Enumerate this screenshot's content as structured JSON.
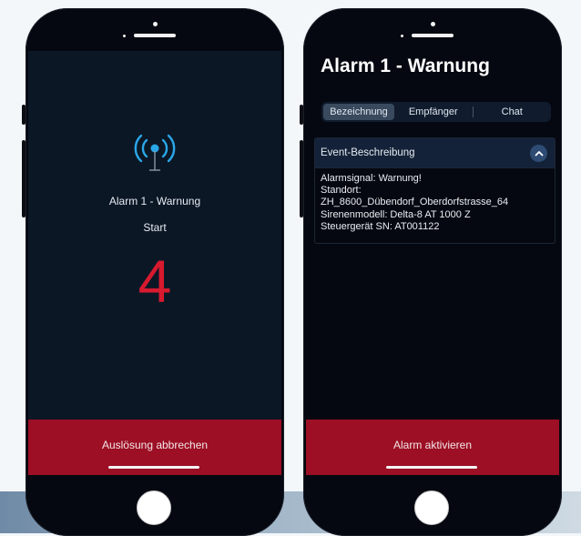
{
  "left_phone": {
    "alarm_title": "Alarm 1 - Warnung",
    "status": "Start",
    "countdown": "4",
    "cancel_button": "Auslösung abbrechen",
    "icon": "broadcast-antenna-icon"
  },
  "right_phone": {
    "title": "Alarm 1 - Warnung",
    "tabs": [
      {
        "label": "Bezeichnung",
        "active": true
      },
      {
        "label": "Empfänger",
        "active": false
      },
      {
        "label": "Chat",
        "active": false
      }
    ],
    "event_section": {
      "header": "Event-Beschreibung",
      "lines": [
        "Alarmsignal: Warnung!",
        "Standort:",
        "ZH_8600_Dübendorf_Oberdorfstrasse_64",
        "Sirenenmodell: Delta-8 AT 1000 Z",
        "Steuergerät SN: AT001122"
      ]
    },
    "activate_button": "Alarm aktivieren"
  },
  "colors": {
    "accent_red": "#9c0f24",
    "countdown_red": "#d71a2f",
    "icon_blue": "#2aa7e8",
    "screen_bg": "#0c1726"
  }
}
